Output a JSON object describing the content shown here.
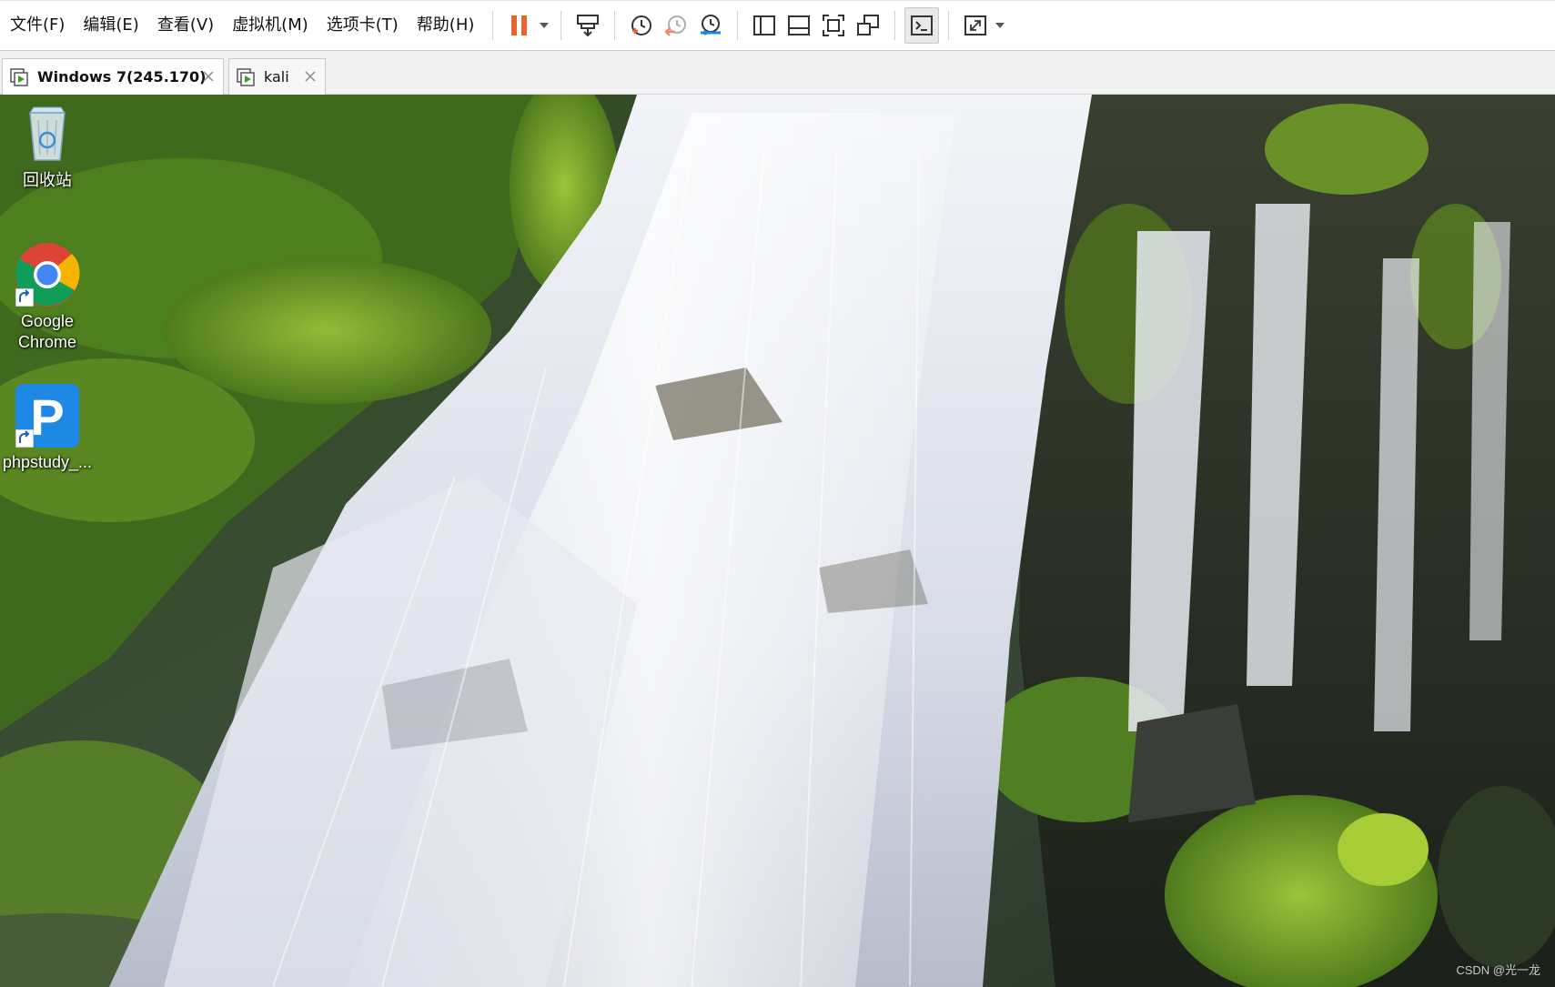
{
  "menu": {
    "items": [
      {
        "label": "文件(F)"
      },
      {
        "label": "编辑(E)"
      },
      {
        "label": "查看(V)"
      },
      {
        "label": "虚拟机(M)"
      },
      {
        "label": "选项卡(T)"
      },
      {
        "label": "帮助(H)"
      }
    ]
  },
  "toolbar": {
    "buttons": [
      {
        "icon": "pause-icon"
      },
      {
        "icon": "send-ctrl-alt-del-icon"
      },
      {
        "icon": "take-snapshot-icon"
      },
      {
        "icon": "revert-snapshot-icon"
      },
      {
        "icon": "snapshot-manager-icon"
      },
      {
        "icon": "show-library-icon"
      },
      {
        "icon": "show-thumbnail-bar-icon"
      },
      {
        "icon": "full-screen-icon"
      },
      {
        "icon": "unity-icon"
      },
      {
        "icon": "console-view-icon"
      },
      {
        "icon": "stretch-guest-icon"
      }
    ],
    "pause_color": "#e8662d"
  },
  "tabs": [
    {
      "label": "Windows 7(245.170)",
      "active": true
    },
    {
      "label": "kali",
      "active": false
    }
  ],
  "desktop": {
    "icons": [
      {
        "label": "回收站",
        "icon": "recycle-bin-icon"
      },
      {
        "label": "Google\nChrome",
        "icon": "chrome-icon"
      },
      {
        "label": "phpstudy_...",
        "icon": "phpstudy-icon",
        "glyph": "P"
      }
    ],
    "watermark": "CSDN @光一龙"
  },
  "colors": {
    "accent_green": "#3f9b2e",
    "phpstudy_blue": "#1e88e5"
  }
}
